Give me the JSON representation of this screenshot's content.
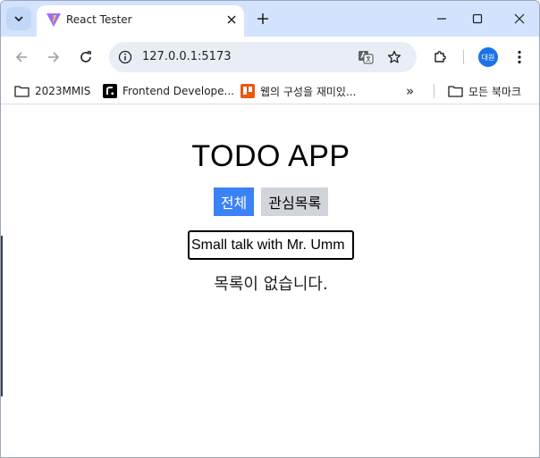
{
  "browser": {
    "tab": {
      "title": "React Tester"
    },
    "url": "127.0.0.1:5173",
    "profile_initials": "대원",
    "accent_color": "#d3e3fd",
    "bookmarks": [
      {
        "label": "2023MMIS",
        "icon": "folder-icon"
      },
      {
        "label": "Frontend Develope...",
        "icon": "roadmap-icon"
      },
      {
        "label": "웹의 구성을 재미있...",
        "icon": "trello-icon"
      }
    ],
    "all_bookmarks_label": "모든 북마크",
    "overflow_label": "»"
  },
  "app": {
    "title": "TODO APP",
    "tabs": [
      {
        "label": "전체",
        "active": true,
        "color": "#3b82f6"
      },
      {
        "label": "관심목록",
        "active": false,
        "color": "#d1d5db"
      }
    ],
    "input_value": "Small talk with Mr. Umm",
    "empty_message": "목록이 없습니다."
  }
}
